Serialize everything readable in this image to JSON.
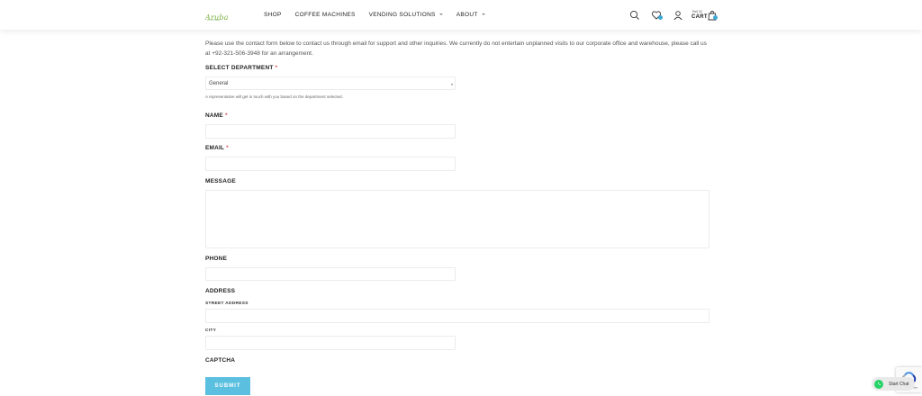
{
  "header": {
    "logo_text": "Aruba",
    "logo_sub": "COFFEE",
    "nav": [
      {
        "label": "SHOP"
      },
      {
        "label": "COFFEE MACHINES"
      },
      {
        "label": "VENDING SOLUTIONS"
      },
      {
        "label": "ABOUT"
      }
    ],
    "cart_small": "Rs0.00",
    "cart_label": "CART",
    "accent_color": "#3fa7d6"
  },
  "intro": "Please use the contact form below to contact us through email for support and other inquiries. We currently do not entertain unplanned visits to our corporate office and warehouse, please call us at +92-321-506-3948 for an arrangement.",
  "form": {
    "department": {
      "label": "SELECT DEPARTMENT",
      "required": "*",
      "value": "General",
      "hint": "A representative will get in touch with you based on the department selected."
    },
    "name": {
      "label": "NAME",
      "required": "*"
    },
    "email": {
      "label": "EMAIL",
      "required": "*"
    },
    "message": {
      "label": "MESSAGE"
    },
    "phone": {
      "label": "PHONE"
    },
    "address": {
      "label": "ADDRESS",
      "street_label": "STREET ADDRESS",
      "city_label": "CITY"
    },
    "captcha": {
      "label": "CAPTCHA"
    },
    "submit_label": "SUBMIT",
    "submit_color": "#5bc0e0"
  },
  "chat": {
    "label": "Start Chat",
    "icon": "whatsapp-icon"
  }
}
